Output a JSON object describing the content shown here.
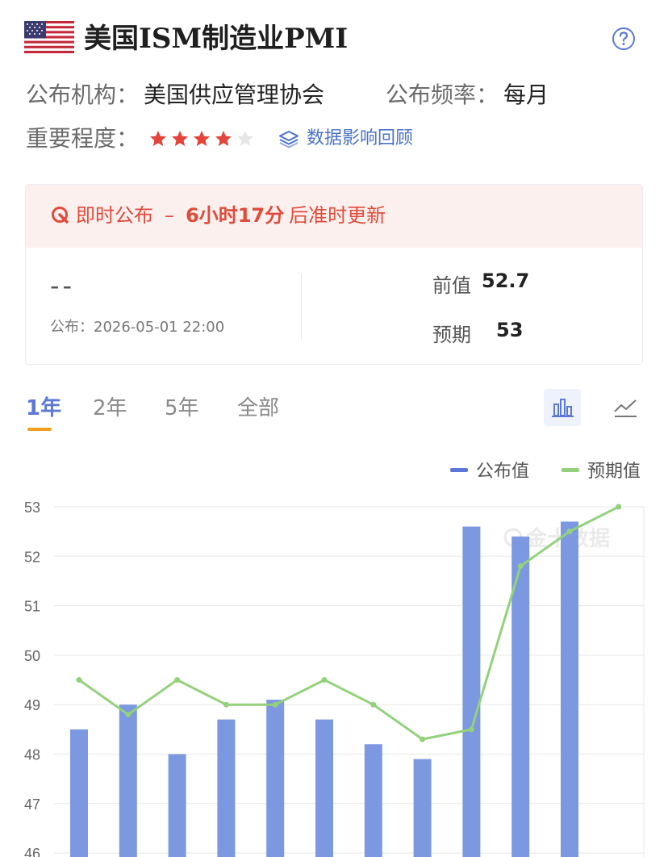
{
  "header": {
    "title": "美国ISM制造业PMI",
    "flag_icon": "us-flag-icon",
    "help_icon": "help-icon"
  },
  "meta": {
    "publisher_label": "公布机构：",
    "publisher_value": "美国供应管理协会",
    "frequency_label": "公布频率：",
    "frequency_value": "每月",
    "importance_label": "重要程度：",
    "importance_stars": 4,
    "importance_max": 5,
    "review_link": "数据影响回顾"
  },
  "release": {
    "status_label": "即时公布",
    "separator": "–",
    "countdown": "6小时17分",
    "countdown_suffix": "后准时更新",
    "actual_value": "--",
    "publish_time": "公布：2026-05-01 22:00",
    "previous_label": "前值",
    "previous_value": "52.7",
    "forecast_label": "预期",
    "forecast_value": "53"
  },
  "tabs": [
    {
      "label": "1年",
      "active": true
    },
    {
      "label": "2年",
      "active": false
    },
    {
      "label": "5年",
      "active": false
    },
    {
      "label": "全部",
      "active": false
    }
  ],
  "colors": {
    "accent": "#5c78d6",
    "bar": "#7b98e0",
    "forecast_line": "#93d17c",
    "alert": "#e04b3a",
    "star": "#e5443b",
    "tab_underline": "#f0a020"
  },
  "chart_data": {
    "type": "bar",
    "watermark": "金十数据",
    "legend_position": "top-right",
    "ylim": [
      46,
      53
    ],
    "yticks": [
      46,
      47,
      48,
      49,
      50,
      51,
      52,
      53
    ],
    "series": [
      {
        "name": "公布值",
        "kind": "bar",
        "values": [
          48.5,
          49.0,
          48.0,
          48.7,
          49.1,
          48.7,
          48.2,
          47.9,
          52.6,
          52.4,
          52.7,
          null
        ]
      },
      {
        "name": "预期值",
        "kind": "line",
        "values": [
          49.5,
          48.8,
          49.5,
          49.0,
          49.0,
          49.5,
          49.0,
          48.3,
          48.5,
          51.8,
          52.5,
          53.0
        ]
      }
    ],
    "grid": true
  }
}
